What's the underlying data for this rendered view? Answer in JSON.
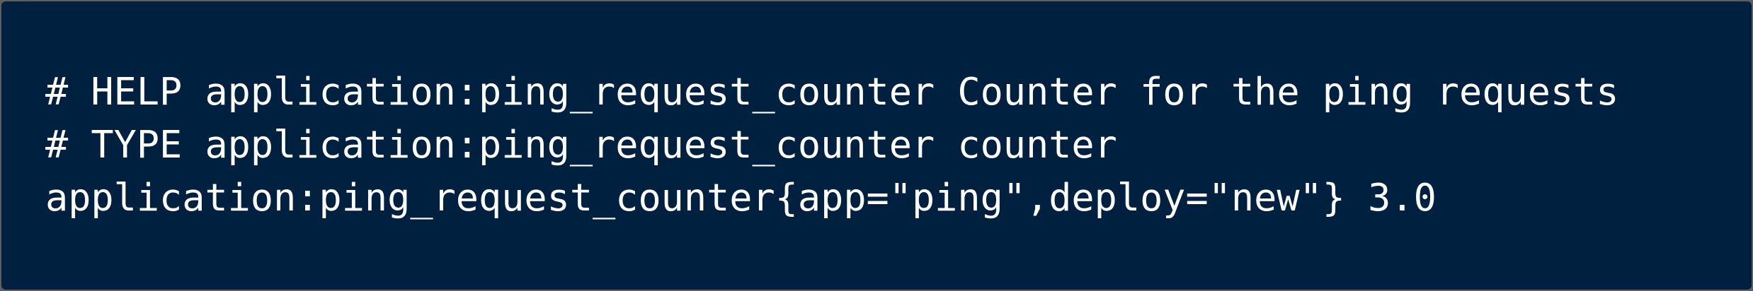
{
  "code": {
    "lines": [
      "# HELP application:ping_request_counter Counter for the ping requests",
      "# TYPE application:ping_request_counter counter",
      "application:ping_request_counter{app=\"ping\",deploy=\"new\"} 3.0"
    ]
  },
  "colors": {
    "background": "#00203f",
    "text": "#ffffff"
  }
}
